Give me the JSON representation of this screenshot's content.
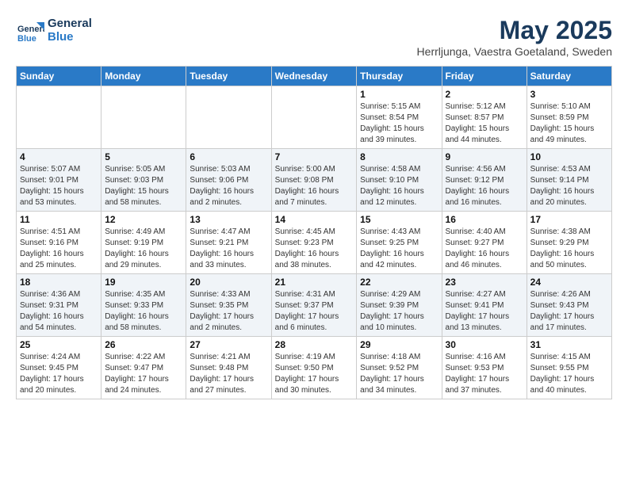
{
  "logo": {
    "line1": "General",
    "line2": "Blue"
  },
  "title": "May 2025",
  "location": "Herrljunga, Vaestra Goetaland, Sweden",
  "headers": [
    "Sunday",
    "Monday",
    "Tuesday",
    "Wednesday",
    "Thursday",
    "Friday",
    "Saturday"
  ],
  "weeks": [
    [
      {
        "day": "",
        "text": ""
      },
      {
        "day": "",
        "text": ""
      },
      {
        "day": "",
        "text": ""
      },
      {
        "day": "",
        "text": ""
      },
      {
        "day": "1",
        "text": "Sunrise: 5:15 AM\nSunset: 8:54 PM\nDaylight: 15 hours\nand 39 minutes."
      },
      {
        "day": "2",
        "text": "Sunrise: 5:12 AM\nSunset: 8:57 PM\nDaylight: 15 hours\nand 44 minutes."
      },
      {
        "day": "3",
        "text": "Sunrise: 5:10 AM\nSunset: 8:59 PM\nDaylight: 15 hours\nand 49 minutes."
      }
    ],
    [
      {
        "day": "4",
        "text": "Sunrise: 5:07 AM\nSunset: 9:01 PM\nDaylight: 15 hours\nand 53 minutes."
      },
      {
        "day": "5",
        "text": "Sunrise: 5:05 AM\nSunset: 9:03 PM\nDaylight: 15 hours\nand 58 minutes."
      },
      {
        "day": "6",
        "text": "Sunrise: 5:03 AM\nSunset: 9:06 PM\nDaylight: 16 hours\nand 2 minutes."
      },
      {
        "day": "7",
        "text": "Sunrise: 5:00 AM\nSunset: 9:08 PM\nDaylight: 16 hours\nand 7 minutes."
      },
      {
        "day": "8",
        "text": "Sunrise: 4:58 AM\nSunset: 9:10 PM\nDaylight: 16 hours\nand 12 minutes."
      },
      {
        "day": "9",
        "text": "Sunrise: 4:56 AM\nSunset: 9:12 PM\nDaylight: 16 hours\nand 16 minutes."
      },
      {
        "day": "10",
        "text": "Sunrise: 4:53 AM\nSunset: 9:14 PM\nDaylight: 16 hours\nand 20 minutes."
      }
    ],
    [
      {
        "day": "11",
        "text": "Sunrise: 4:51 AM\nSunset: 9:16 PM\nDaylight: 16 hours\nand 25 minutes."
      },
      {
        "day": "12",
        "text": "Sunrise: 4:49 AM\nSunset: 9:19 PM\nDaylight: 16 hours\nand 29 minutes."
      },
      {
        "day": "13",
        "text": "Sunrise: 4:47 AM\nSunset: 9:21 PM\nDaylight: 16 hours\nand 33 minutes."
      },
      {
        "day": "14",
        "text": "Sunrise: 4:45 AM\nSunset: 9:23 PM\nDaylight: 16 hours\nand 38 minutes."
      },
      {
        "day": "15",
        "text": "Sunrise: 4:43 AM\nSunset: 9:25 PM\nDaylight: 16 hours\nand 42 minutes."
      },
      {
        "day": "16",
        "text": "Sunrise: 4:40 AM\nSunset: 9:27 PM\nDaylight: 16 hours\nand 46 minutes."
      },
      {
        "day": "17",
        "text": "Sunrise: 4:38 AM\nSunset: 9:29 PM\nDaylight: 16 hours\nand 50 minutes."
      }
    ],
    [
      {
        "day": "18",
        "text": "Sunrise: 4:36 AM\nSunset: 9:31 PM\nDaylight: 16 hours\nand 54 minutes."
      },
      {
        "day": "19",
        "text": "Sunrise: 4:35 AM\nSunset: 9:33 PM\nDaylight: 16 hours\nand 58 minutes."
      },
      {
        "day": "20",
        "text": "Sunrise: 4:33 AM\nSunset: 9:35 PM\nDaylight: 17 hours\nand 2 minutes."
      },
      {
        "day": "21",
        "text": "Sunrise: 4:31 AM\nSunset: 9:37 PM\nDaylight: 17 hours\nand 6 minutes."
      },
      {
        "day": "22",
        "text": "Sunrise: 4:29 AM\nSunset: 9:39 PM\nDaylight: 17 hours\nand 10 minutes."
      },
      {
        "day": "23",
        "text": "Sunrise: 4:27 AM\nSunset: 9:41 PM\nDaylight: 17 hours\nand 13 minutes."
      },
      {
        "day": "24",
        "text": "Sunrise: 4:26 AM\nSunset: 9:43 PM\nDaylight: 17 hours\nand 17 minutes."
      }
    ],
    [
      {
        "day": "25",
        "text": "Sunrise: 4:24 AM\nSunset: 9:45 PM\nDaylight: 17 hours\nand 20 minutes."
      },
      {
        "day": "26",
        "text": "Sunrise: 4:22 AM\nSunset: 9:47 PM\nDaylight: 17 hours\nand 24 minutes."
      },
      {
        "day": "27",
        "text": "Sunrise: 4:21 AM\nSunset: 9:48 PM\nDaylight: 17 hours\nand 27 minutes."
      },
      {
        "day": "28",
        "text": "Sunrise: 4:19 AM\nSunset: 9:50 PM\nDaylight: 17 hours\nand 30 minutes."
      },
      {
        "day": "29",
        "text": "Sunrise: 4:18 AM\nSunset: 9:52 PM\nDaylight: 17 hours\nand 34 minutes."
      },
      {
        "day": "30",
        "text": "Sunrise: 4:16 AM\nSunset: 9:53 PM\nDaylight: 17 hours\nand 37 minutes."
      },
      {
        "day": "31",
        "text": "Sunrise: 4:15 AM\nSunset: 9:55 PM\nDaylight: 17 hours\nand 40 minutes."
      }
    ]
  ]
}
